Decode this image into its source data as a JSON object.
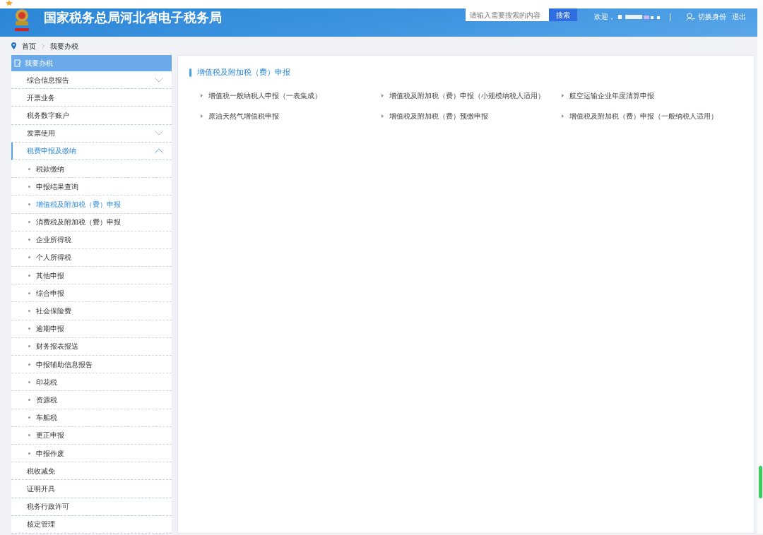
{
  "header": {
    "title": "国家税务总局河北省电子税务局",
    "search": {
      "placeholder": "请输入需要搜索的内容",
      "button": "搜索"
    },
    "welcome": "欢迎，",
    "separator": "|",
    "switch_identity": "切换身份",
    "logout": "退出"
  },
  "breadcrumb": [
    "首页",
    "我要办税"
  ],
  "sidebar": {
    "title": "我要办税",
    "items": [
      {
        "label": "综合信息报告",
        "expandable": true,
        "expanded": false,
        "selected": false
      },
      {
        "label": "开票业务",
        "expandable": false,
        "expanded": false,
        "selected": false
      },
      {
        "label": "税务数字账户",
        "expandable": false,
        "expanded": false,
        "selected": false
      },
      {
        "label": "发票使用",
        "expandable": true,
        "expanded": false,
        "selected": false
      },
      {
        "label": "税费申报及缴纳",
        "expandable": true,
        "expanded": true,
        "selected": true,
        "children": [
          {
            "label": "税款缴纳",
            "selected": false
          },
          {
            "label": "申报结果查询",
            "selected": false
          },
          {
            "label": "增值税及附加税（费）申报",
            "selected": true
          },
          {
            "label": "消费税及附加税（费）申报",
            "selected": false
          },
          {
            "label": "企业所得税",
            "selected": false
          },
          {
            "label": "个人所得税",
            "selected": false
          },
          {
            "label": "其他申报",
            "selected": false
          },
          {
            "label": "综合申报",
            "selected": false
          },
          {
            "label": "社会保险费",
            "selected": false
          },
          {
            "label": "逾期申报",
            "selected": false
          },
          {
            "label": "财务报表报送",
            "selected": false
          },
          {
            "label": "申报辅助信息报告",
            "selected": false
          },
          {
            "label": "印花税",
            "selected": false
          },
          {
            "label": "资源税",
            "selected": false
          },
          {
            "label": "车船税",
            "selected": false
          },
          {
            "label": "更正申报",
            "selected": false
          },
          {
            "label": "申报作废",
            "selected": false
          }
        ]
      },
      {
        "label": "税收减免",
        "expandable": false,
        "expanded": false,
        "selected": false
      },
      {
        "label": "证明开具",
        "expandable": false,
        "expanded": false,
        "selected": false
      },
      {
        "label": "税务行政许可",
        "expandable": false,
        "expanded": false,
        "selected": false
      },
      {
        "label": "核定管理",
        "expandable": false,
        "expanded": false,
        "selected": false
      }
    ]
  },
  "content": {
    "title": "增值税及附加税（费）申报",
    "links": [
      "增值税一般纳税人申报（一表集成）",
      "增值税及附加税（费）申报（小规模纳税人适用）",
      "航空运输企业年度清算申报",
      "原油天然气增值税申报",
      "增值税及附加税（费）预缴申报",
      "增值税及附加税（费）申报（一般纳税人适用）"
    ]
  }
}
